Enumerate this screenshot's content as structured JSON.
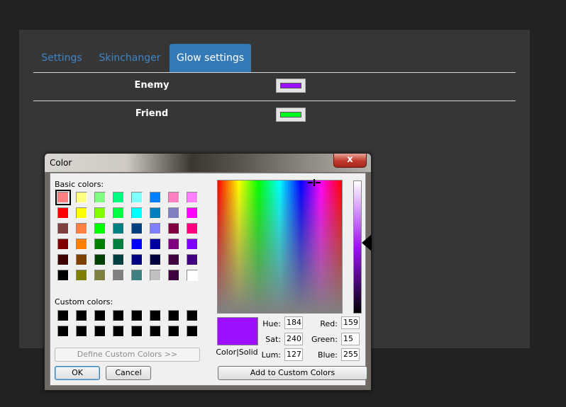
{
  "tabs": [
    {
      "label": "Settings",
      "active": false
    },
    {
      "label": "Skinchanger",
      "active": false
    },
    {
      "label": "Glow settings",
      "active": true
    }
  ],
  "glow_rows": [
    {
      "label": "Enemy",
      "color": "#9f0fff"
    },
    {
      "label": "Friend",
      "color": "#00ff20"
    }
  ],
  "dialog": {
    "title": "Color",
    "close_glyph": "x",
    "basic_colors_label": "Basic colors:",
    "custom_colors_label": "Custom colors:",
    "define_custom_label": "Define Custom Colors >>",
    "ok_label": "OK",
    "cancel_label": "Cancel",
    "add_custom_label": "Add to Custom Colors",
    "color_solid_label": "Color|Solid",
    "preview_color": "#9f0fff",
    "hue_label": "Hue:",
    "hue": "184",
    "sat_label": "Sat:",
    "sat": "240",
    "lum_label": "Lum:",
    "lum": "127",
    "red_label": "Red:",
    "red": "159",
    "green_label": "Green:",
    "green": "15",
    "blue_label": "Blue:",
    "blue": "255",
    "basic_colors": [
      [
        "#ff8080",
        "#ffff80",
        "#80ff80",
        "#00ff80",
        "#80ffff",
        "#0080ff",
        "#ff80c0",
        "#ff80ff"
      ],
      [
        "#ff0000",
        "#ffff00",
        "#80ff00",
        "#00ff40",
        "#00ffff",
        "#0080c0",
        "#8080c0",
        "#ff00ff"
      ],
      [
        "#804040",
        "#ff8040",
        "#00ff00",
        "#008080",
        "#004080",
        "#8080ff",
        "#800040",
        "#ff0080"
      ],
      [
        "#800000",
        "#ff8000",
        "#008000",
        "#008040",
        "#0000ff",
        "#0000a0",
        "#800080",
        "#8000ff"
      ],
      [
        "#400000",
        "#804000",
        "#004000",
        "#004040",
        "#000080",
        "#000040",
        "#400040",
        "#400080"
      ],
      [
        "#000000",
        "#808000",
        "#808040",
        "#808080",
        "#408080",
        "#c0c0c0",
        "#400040",
        "#ffffff"
      ]
    ],
    "custom_colors": [
      [
        "#000000",
        "#000000",
        "#000000",
        "#000000",
        "#000000",
        "#000000",
        "#000000",
        "#000000"
      ],
      [
        "#000000",
        "#000000",
        "#000000",
        "#000000",
        "#000000",
        "#000000",
        "#000000",
        "#000000"
      ]
    ]
  }
}
